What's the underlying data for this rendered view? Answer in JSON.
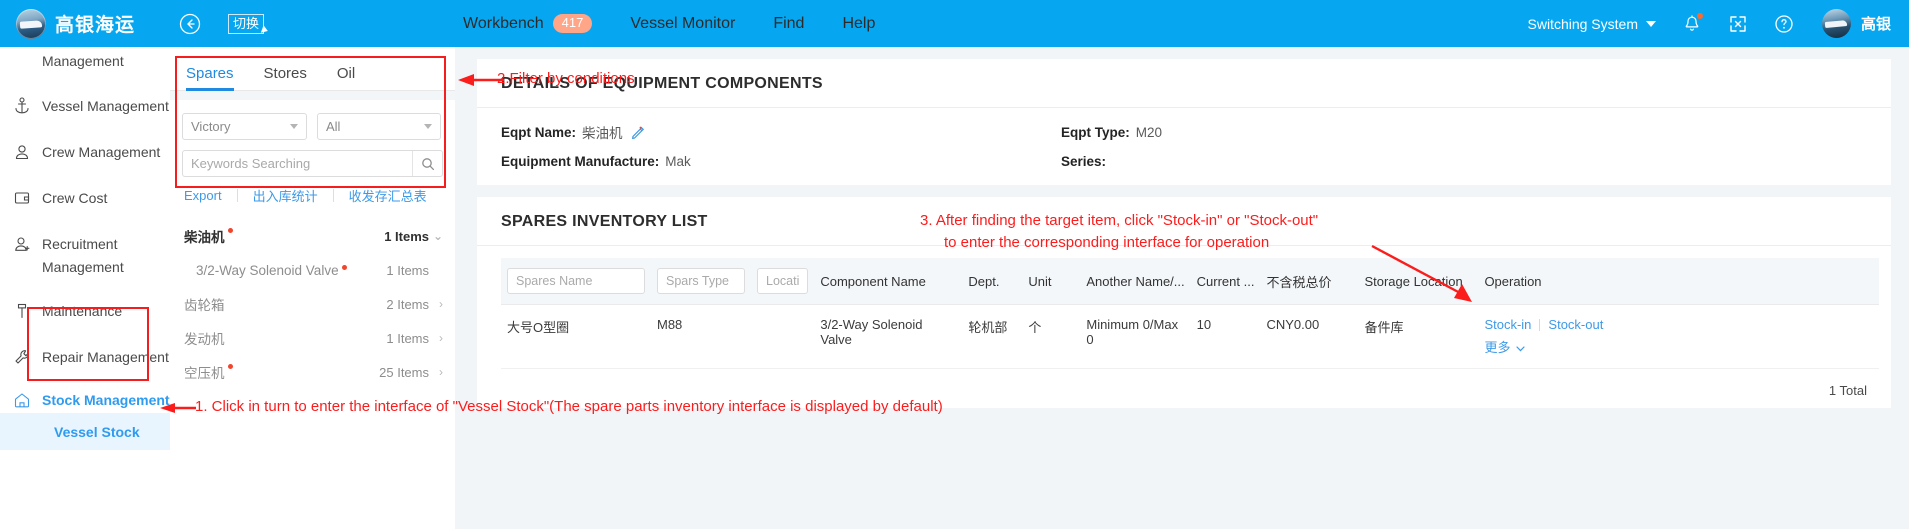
{
  "topbar": {
    "brand": "高银海运",
    "logo_icon": "ship-logo",
    "collapse_icon": "collapse-left-icon",
    "switch_label": "切换",
    "nav": [
      {
        "label": "Workbench",
        "badge": "417"
      },
      {
        "label": "Vessel Monitor",
        "badge": ""
      },
      {
        "label": "Find",
        "badge": ""
      },
      {
        "label": "Help",
        "badge": ""
      }
    ],
    "switching_system": "Switching System",
    "bell_icon": "bell-icon",
    "fullscreen_icon": "fullscreen-icon",
    "help_icon": "question-circle-icon",
    "user_name": "高银",
    "avatar_icon": "user-avatar"
  },
  "sidebar": {
    "top_partial_label": "Management",
    "items": [
      {
        "label": "Vessel Management",
        "icon": "anchor-icon",
        "arrow": "›",
        "wrap": ""
      },
      {
        "label": "Crew Management",
        "icon": "person-icon",
        "arrow": "›",
        "wrap": ""
      },
      {
        "label": "Crew Cost",
        "icon": "wallet-icon",
        "arrow": "›",
        "wrap": ""
      },
      {
        "label": "Recruitment",
        "icon": "person-add-icon",
        "arrow": "›",
        "wrap": "Management"
      },
      {
        "label": "Maintenance",
        "icon": "hammer-icon",
        "arrow": "›",
        "wrap": ""
      },
      {
        "label": "Repair Management",
        "icon": "wrench-icon",
        "arrow": "›",
        "wrap": ""
      }
    ],
    "stock_management": {
      "label": "Stock Management",
      "icon": "home-icon",
      "chevron": "⌄"
    },
    "sub_item": "Vessel Stock"
  },
  "filter_panel": {
    "tabs": [
      {
        "label": "Spares",
        "active": true
      },
      {
        "label": "Stores",
        "active": false
      },
      {
        "label": "Oil",
        "active": false
      }
    ],
    "vessel_select": {
      "value": "Victory"
    },
    "type_select": {
      "value": "All"
    },
    "search": {
      "value": "",
      "placeholder": "Keywords Searching",
      "icon": "search-icon"
    },
    "links": [
      "Export",
      "出入库统计",
      "收发存汇总表"
    ],
    "tree": [
      {
        "label": "柴油机",
        "dot": true,
        "count": "1 Items",
        "chevron": "⌄",
        "level": 0
      },
      {
        "label": "3/2-Way Solenoid Valve",
        "dot": true,
        "count": "1 Items",
        "chevron": "",
        "level": 1
      },
      {
        "label": "齿轮箱",
        "dot": false,
        "count": "2 Items",
        "chevron": "›",
        "level": 0
      },
      {
        "label": "发动机",
        "dot": false,
        "count": "1 Items",
        "chevron": "›",
        "level": 0
      },
      {
        "label": "空压机",
        "dot": true,
        "count": "25 Items",
        "chevron": "›",
        "level": 0
      }
    ]
  },
  "details_card": {
    "title": "DETAILS OF EQUIPMENT COMPONENTS",
    "rows": [
      {
        "label": "Eqpt Name:",
        "value": "柴油机",
        "edit_icon": "edit-pencil-icon",
        "label2": "Eqpt Type:",
        "value2": "M20"
      },
      {
        "label": "Equipment Manufacture:",
        "value": "Mak",
        "edit_icon": "",
        "label2": "Series:",
        "value2": ""
      }
    ]
  },
  "inventory_card": {
    "title": "SPARES INVENTORY LIST",
    "columns": [
      {
        "type": "input",
        "placeholder": "Spares Name"
      },
      {
        "type": "input",
        "placeholder": "Spars Type"
      },
      {
        "type": "input",
        "placeholder": "Locati"
      },
      {
        "type": "text",
        "label": "Component Name"
      },
      {
        "type": "text",
        "label": "Dept."
      },
      {
        "type": "text",
        "label": "Unit"
      },
      {
        "type": "text",
        "label": "Another Name/..."
      },
      {
        "type": "text",
        "label": "Current ..."
      },
      {
        "type": "text",
        "label": "不含税总价"
      },
      {
        "type": "text",
        "label": "Storage Location"
      },
      {
        "type": "text",
        "label": "Operation"
      }
    ],
    "rows": [
      {
        "spares_name": "大号O型圈",
        "spars_type": "M88",
        "location": "",
        "component_name": "3/2-Way Solenoid Valve",
        "dept": "轮机部",
        "unit": "个",
        "another_name": "Minimum 0/Max 0",
        "current": "10",
        "price": "CNY0.00",
        "storage_location": "备件库",
        "op_stock_in": "Stock-in",
        "op_stock_out": "Stock-out",
        "op_more": "更多"
      }
    ],
    "total": "1 Total"
  },
  "annotations": {
    "step2": "2.Filter by conditions",
    "step3_line1": "3. After finding the target item, click \"Stock-in\" or \"Stock-out\"",
    "step3_line2": "to enter the corresponding interface for operation",
    "step1": "1. Click in turn to enter the interface of \"Vessel Stock\"(The spare parts inventory interface is displayed by default)"
  },
  "colors": {
    "brand_blue": "#06a7f0",
    "link_blue": "#3d9ae8",
    "annotation_red": "#fb1c1c",
    "badge_orange": "#ffa588"
  }
}
